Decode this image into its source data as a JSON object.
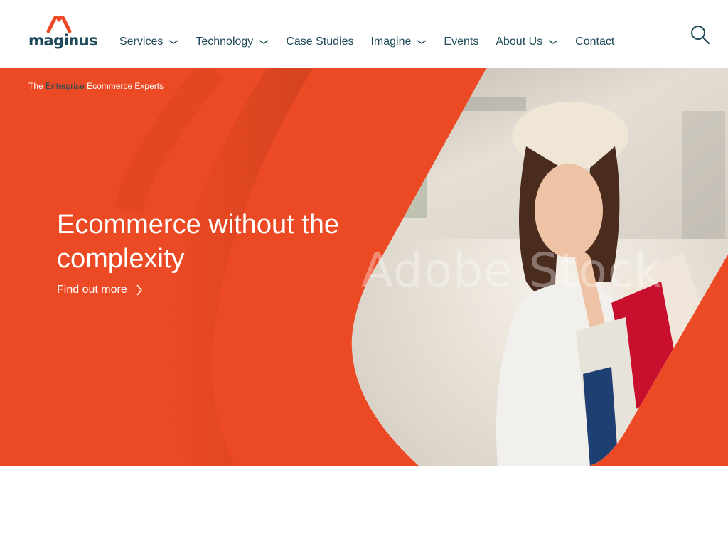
{
  "brand": {
    "name": "maginus"
  },
  "nav": {
    "items": [
      {
        "label": "Services",
        "has_dropdown": true
      },
      {
        "label": "Technology",
        "has_dropdown": true
      },
      {
        "label": "Case Studies",
        "has_dropdown": false
      },
      {
        "label": "Imagine",
        "has_dropdown": true
      },
      {
        "label": "Events",
        "has_dropdown": false
      },
      {
        "label": "About Us",
        "has_dropdown": true
      },
      {
        "label": "Contact",
        "has_dropdown": false
      }
    ]
  },
  "hero": {
    "tagline_pre": "The",
    "tagline_em": "Enterprise",
    "tagline_post": "Ecommerce Experts",
    "headline": "Ecommerce without the complexity",
    "cta_label": "Find out more",
    "watermark": "Adobe Stock"
  },
  "colors": {
    "accent": "#ec4a24",
    "navy": "#1f4a5a",
    "white": "#ffffff"
  },
  "icons": {
    "search": "search-icon",
    "chevron": "chevron-down-icon",
    "cta_arrow": "chevron-right-icon"
  }
}
